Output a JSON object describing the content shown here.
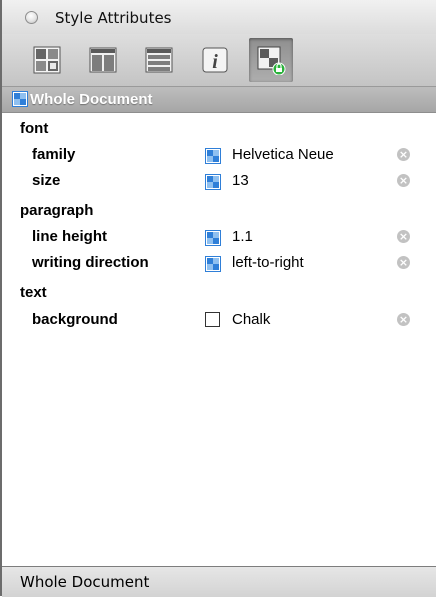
{
  "window": {
    "title": "Style Attributes"
  },
  "toolbar": {
    "tools": [
      {
        "icon": "style-layout-icon"
      },
      {
        "icon": "columns-icon"
      },
      {
        "icon": "rows-icon"
      },
      {
        "icon": "info-icon"
      },
      {
        "icon": "locked-style-icon",
        "active": true
      }
    ]
  },
  "header": {
    "label": "Whole Document"
  },
  "groups": [
    {
      "label": "font"
    },
    {
      "label": "paragraph"
    },
    {
      "label": "text"
    }
  ],
  "attributes": [
    {
      "name": "family",
      "value": "Helvetica Neue"
    },
    {
      "name": "size",
      "value": "13"
    },
    {
      "name": "line height",
      "value": "1.1"
    },
    {
      "name": "writing direction",
      "value": "left-to-right"
    },
    {
      "name": "background",
      "value": "Chalk",
      "swatch_color": "#ffffff"
    }
  ],
  "footer": {
    "label": "Whole Document"
  },
  "colors": {
    "accent": "#2f7fd8",
    "header": "#b0b0b0"
  }
}
